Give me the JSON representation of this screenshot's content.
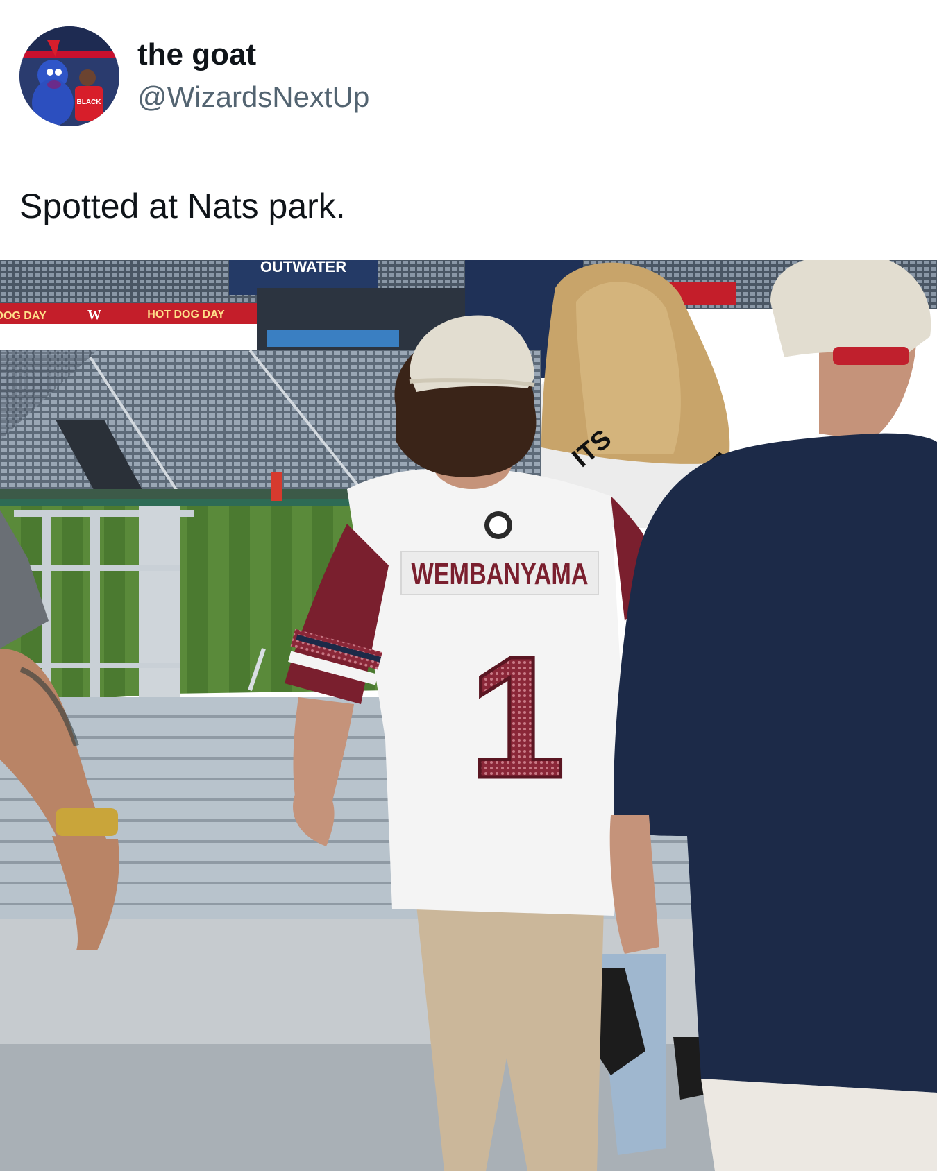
{
  "tweet": {
    "display_name": "the goat",
    "handle": "@WizardsNextUp",
    "text": "Spotted at Nats park."
  },
  "photo": {
    "signs": {
      "upper": "OUTWATER",
      "banner_left": "DOG DAY",
      "banner_right": "HOT DOG DAY",
      "banner_logo": "W"
    },
    "jersey": {
      "name": "WEMBANYAMA",
      "number": "1"
    },
    "shirt_letters_left": "ITS",
    "shirt_letters_right": "A"
  },
  "colors": {
    "name": "#0f1419",
    "handle": "#536471",
    "jersey_maroon": "#7a1f2e",
    "navy": "#1c2a48"
  }
}
